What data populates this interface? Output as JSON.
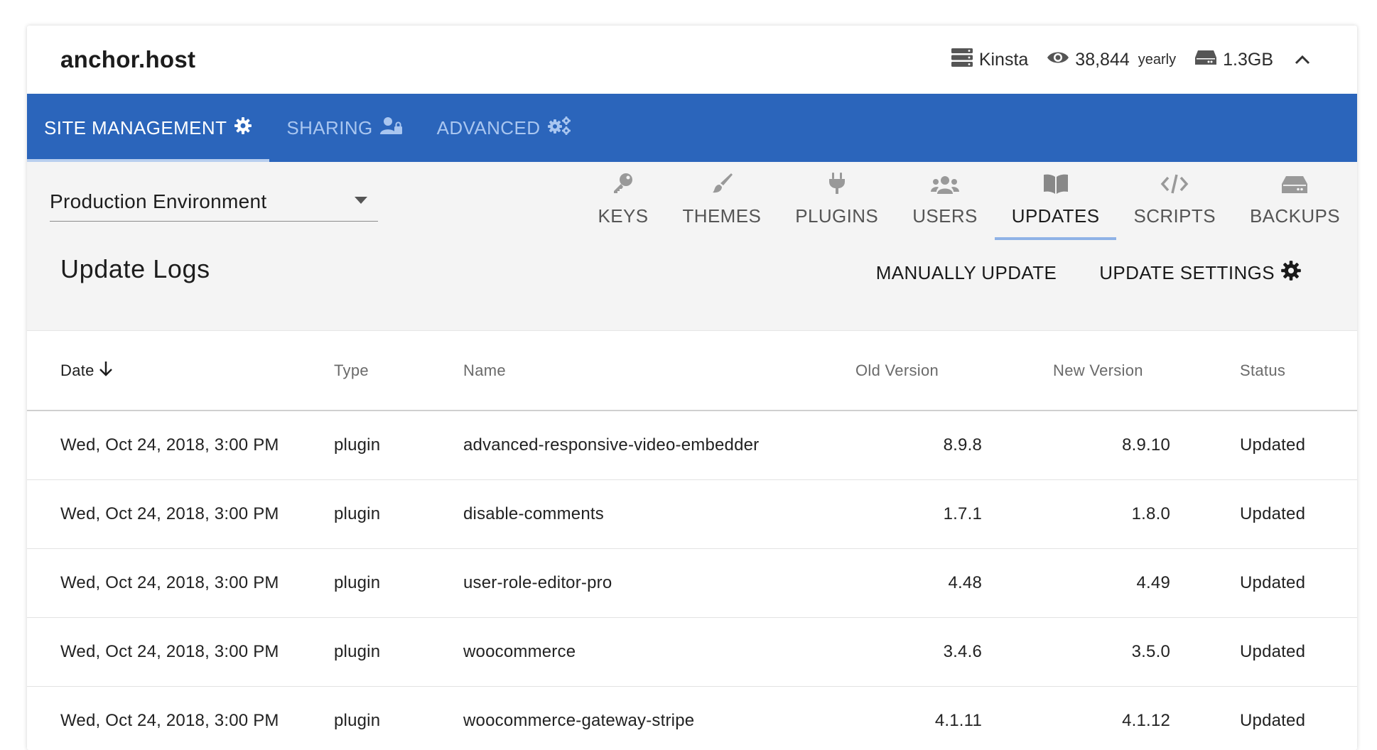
{
  "site": {
    "name": "anchor.host"
  },
  "meta": {
    "host": "Kinsta",
    "visits": "38,844",
    "visits_period": "yearly",
    "storage": "1.3GB",
    "icons": [
      "server-icon",
      "eye-icon",
      "hard-drive-icon",
      "chevron-up-icon"
    ]
  },
  "main_tabs": [
    {
      "label": "SITE MANAGEMENT",
      "icon": "gear-icon",
      "active": true
    },
    {
      "label": "SHARING",
      "icon": "user-lock-icon",
      "active": false
    },
    {
      "label": "ADVANCED",
      "icon": "gears-icon",
      "active": false
    }
  ],
  "environment": {
    "selected": "Production Environment"
  },
  "sub_tabs": [
    {
      "label": "KEYS",
      "icon": "key-icon"
    },
    {
      "label": "THEMES",
      "icon": "paintbrush-icon"
    },
    {
      "label": "PLUGINS",
      "icon": "plug-icon"
    },
    {
      "label": "USERS",
      "icon": "users-icon"
    },
    {
      "label": "UPDATES",
      "icon": "book-icon",
      "active": true
    },
    {
      "label": "SCRIPTS",
      "icon": "code-icon"
    },
    {
      "label": "BACKUPS",
      "icon": "hdd-icon"
    }
  ],
  "logs": {
    "title": "Update Logs",
    "manual_update": "MANUALLY UPDATE",
    "update_settings": "UPDATE SETTINGS"
  },
  "table": {
    "headers": {
      "date": "Date",
      "type": "Type",
      "name": "Name",
      "old": "Old Version",
      "new": "New Version",
      "status": "Status"
    },
    "rows": [
      {
        "date": "Wed, Oct 24, 2018, 3:00 PM",
        "type": "plugin",
        "name": "advanced-responsive-video-embedder",
        "old": "8.9.8",
        "new": "8.9.10",
        "status": "Updated"
      },
      {
        "date": "Wed, Oct 24, 2018, 3:00 PM",
        "type": "plugin",
        "name": "disable-comments",
        "old": "1.7.1",
        "new": "1.8.0",
        "status": "Updated"
      },
      {
        "date": "Wed, Oct 24, 2018, 3:00 PM",
        "type": "plugin",
        "name": "user-role-editor-pro",
        "old": "4.48",
        "new": "4.49",
        "status": "Updated"
      },
      {
        "date": "Wed, Oct 24, 2018, 3:00 PM",
        "type": "plugin",
        "name": "woocommerce",
        "old": "3.4.6",
        "new": "3.5.0",
        "status": "Updated"
      },
      {
        "date": "Wed, Oct 24, 2018, 3:00 PM",
        "type": "plugin",
        "name": "woocommerce-gateway-stripe",
        "old": "4.1.11",
        "new": "4.1.12",
        "status": "Updated"
      }
    ]
  },
  "colors": {
    "nav_bg": "#2b65bb",
    "nav_active_text": "#ffffff",
    "nav_inactive_text": "#a9c6f0",
    "sub_bg": "#f4f4f4"
  }
}
